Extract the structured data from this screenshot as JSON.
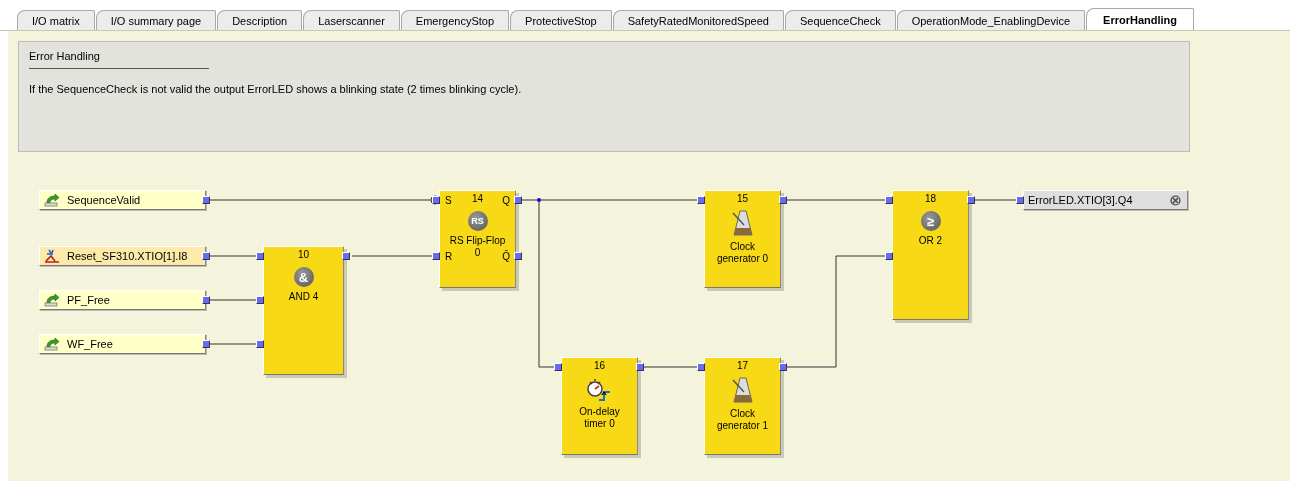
{
  "tabs": [
    {
      "label": "I/O matrix",
      "selected": false
    },
    {
      "label": "I/O summary page",
      "selected": false
    },
    {
      "label": "Description",
      "selected": false
    },
    {
      "label": "Laserscanner",
      "selected": false
    },
    {
      "label": "EmergencyStop",
      "selected": false
    },
    {
      "label": "ProtectiveStop",
      "selected": false
    },
    {
      "label": "SafetyRatedMonitoredSpeed",
      "selected": false
    },
    {
      "label": "SequenceCheck",
      "selected": false
    },
    {
      "label": "OperationMode_EnablingDevice",
      "selected": false
    },
    {
      "label": "ErrorHandling",
      "selected": true
    }
  ],
  "comment": {
    "title": "Error Handling",
    "body": "If the SequenceCheck is not valid the output ErrorLED shows a blinking state (2 times blinking cycle)."
  },
  "inputs": [
    {
      "label": "SequenceValid",
      "kind": "variable"
    },
    {
      "label": "Reset_SF310.XTIO[1].I8",
      "kind": "hardware"
    },
    {
      "label": "PF_Free",
      "kind": "variable"
    },
    {
      "label": "WF_Free",
      "kind": "variable"
    }
  ],
  "blocks": [
    {
      "number": "10",
      "label": "AND 4",
      "kind": "logic",
      "symbol": "&"
    },
    {
      "number": "14",
      "label": "RS Flip-Flop 0",
      "kind": "logic",
      "symbol": "RS",
      "ports": [
        "S",
        "R",
        "Q",
        "Q̄"
      ],
      "negated_input": true
    },
    {
      "number": "15",
      "label": "Clock generator 0",
      "kind": "clock"
    },
    {
      "number": "16",
      "label": "On-delay timer 0",
      "kind": "timer"
    },
    {
      "number": "17",
      "label": "Clock generator 1",
      "kind": "clock"
    },
    {
      "number": "18",
      "label": "OR 2",
      "kind": "logic",
      "symbol": "≥"
    }
  ],
  "output": {
    "label": "ErrorLED.XTIO[3].Q4"
  }
}
